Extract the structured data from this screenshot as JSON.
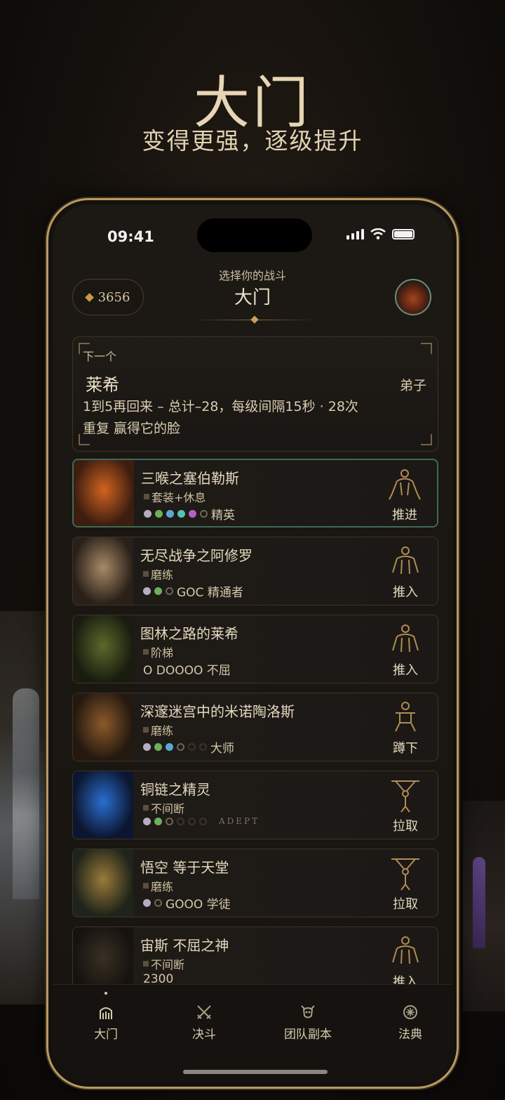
{
  "promo": {
    "title": "大门",
    "subtitle": "变得更强，逐级提升"
  },
  "status_bar": {
    "time": "09:41"
  },
  "header": {
    "kicker": "选择你的战斗",
    "title": "大门",
    "currency": "3656"
  },
  "next": {
    "label": "下一个",
    "name": "莱希",
    "role": "弟子",
    "description": "1到5再回来 – 总计–28，每级间隔15秒 · 28次重复 赢得它的脸"
  },
  "bosses": [
    {
      "name": "三喉之塞伯勒斯",
      "tag": "套装+休息",
      "meta": "精英",
      "action": "推进",
      "active": true,
      "gems": [
        "#b6aec0",
        "#6bb05a",
        "#5aa9d4",
        "#55c0b5",
        "#b061c9",
        "o"
      ],
      "portrait": [
        "#d2631f",
        "#3c1d10"
      ]
    },
    {
      "name": "无尽战争之阿修罗",
      "tag": "磨练",
      "meta": "GOC 精通者",
      "action": "推入",
      "active": false,
      "gems": [
        "#b6aec0",
        "#6bb05a",
        "o"
      ],
      "portrait": [
        "#a88a66",
        "#2a2019"
      ]
    },
    {
      "name": "图林之路的莱希",
      "tag": "阶梯",
      "meta": "O DOOOO 不屈",
      "action": "推入",
      "active": false,
      "gems": [],
      "portrait": [
        "#5a6a2a",
        "#1a1c10"
      ]
    },
    {
      "name": "深邃迷宫中的米诺陶洛斯",
      "tag": "磨练",
      "meta": "大师",
      "action": "蹲下",
      "active": false,
      "gems": [
        "#b6aec0",
        "#6bb05a",
        "#5aa9d4",
        "o",
        "d",
        "d"
      ],
      "portrait": [
        "#8b5a2a",
        "#24180f"
      ]
    },
    {
      "name": "铜链之精灵",
      "tag": "不间断",
      "meta": "ADEPT",
      "action": "拉取",
      "active": false,
      "gems": [
        "#b6aec0",
        "#6bb05a",
        "o",
        "d",
        "d",
        "d"
      ],
      "portrait": [
        "#2a6fd0",
        "#0c1630"
      ]
    },
    {
      "name": "悟空 等于天堂",
      "tag": "磨练",
      "meta": "GOOO 学徒",
      "action": "拉取",
      "active": false,
      "gems": [
        "#b6aec0",
        "o"
      ],
      "portrait": [
        "#9a7a3a",
        "#1e2419"
      ]
    },
    {
      "name": "宙斯 不屈之神",
      "tag": "不间断",
      "meta": "2300",
      "action": "推入",
      "active": false,
      "gems": [],
      "portrait": [
        "#3a3024",
        "#151210"
      ]
    }
  ],
  "tabs": [
    {
      "label": "大门",
      "icon": "gate-icon",
      "selected": true
    },
    {
      "label": "决斗",
      "icon": "crossed-swords-icon",
      "selected": false
    },
    {
      "label": "团队副本",
      "icon": "demon-mask-icon",
      "selected": false
    },
    {
      "label": "法典",
      "icon": "codex-icon",
      "selected": false
    }
  ]
}
